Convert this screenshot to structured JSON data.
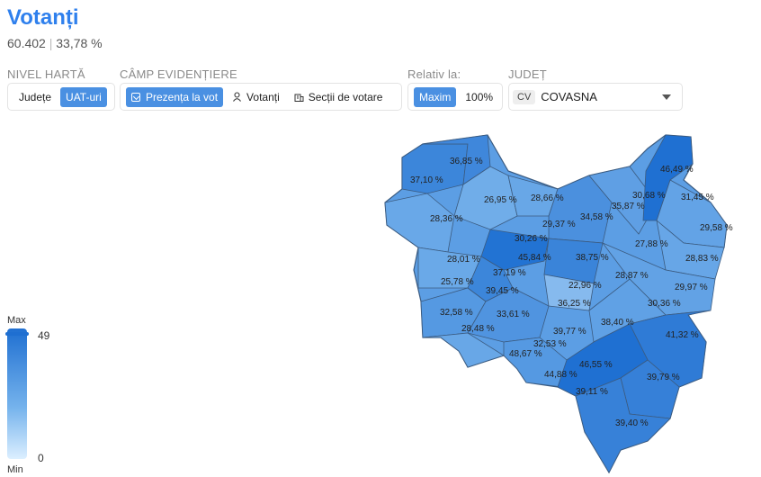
{
  "header": {
    "title": "Votanți",
    "count": "60.402",
    "percent": "33,78 %"
  },
  "nivel_harta": {
    "label": "NIVEL HARTĂ",
    "options": [
      "Județe",
      "UAT-uri"
    ],
    "selected": "UAT-uri"
  },
  "camp": {
    "label": "CÂMP EVIDENȚIERE",
    "options": [
      "Prezența la vot",
      "Votanți",
      "Secții de votare"
    ],
    "selected": "Prezența la vot"
  },
  "relativ": {
    "label": "Relativ la:",
    "options": [
      "Maxim",
      "100%"
    ],
    "selected": "Maxim"
  },
  "judet": {
    "label": "JUDEȚ",
    "code": "CV",
    "name": "COVASNA"
  },
  "legend": {
    "max_label": "Max",
    "min_label": "Min",
    "max_value": "49",
    "min_value": "0",
    "scale_colors": [
      "#1f6fd1",
      "#74b2ec",
      "#dcefff"
    ]
  },
  "map": {
    "regions": [
      {
        "label": "36,85 %",
        "value": 36.85,
        "color": "#3f87db"
      },
      {
        "label": "37,10 %",
        "value": 37.1,
        "color": "#3c86da"
      },
      {
        "label": "28,36 %",
        "value": 28.36,
        "color": "#69a8e8"
      },
      {
        "label": "26,95 %",
        "value": 26.95,
        "color": "#70ade9"
      },
      {
        "label": "28,66 %",
        "value": 28.66,
        "color": "#68a7e7"
      },
      {
        "label": "29,37 %",
        "value": 29.37,
        "color": "#64a4e6"
      },
      {
        "label": "34,58 %",
        "value": 34.58,
        "color": "#4b90de"
      },
      {
        "label": "30,68 %",
        "value": 30.68,
        "color": "#5f9fe4"
      },
      {
        "label": "46,49 %",
        "value": 46.49,
        "color": "#1f70d2"
      },
      {
        "label": "31,45 %",
        "value": 31.45,
        "color": "#5a9ce3"
      },
      {
        "label": "35,87 %",
        "value": 35.87,
        "color": "#448bdc"
      },
      {
        "label": "29,58 %",
        "value": 29.58,
        "color": "#63a3e6"
      },
      {
        "label": "30,26 %",
        "value": 30.26,
        "color": "#60a1e5"
      },
      {
        "label": "27,88 %",
        "value": 27.88,
        "color": "#6baae8"
      },
      {
        "label": "28,83 %",
        "value": 28.83,
        "color": "#67a6e7"
      },
      {
        "label": "28,01 %",
        "value": 28.01,
        "color": "#6aa9e8"
      },
      {
        "label": "45,84 %",
        "value": 45.84,
        "color": "#2273d3"
      },
      {
        "label": "38,75 %",
        "value": 38.75,
        "color": "#3a84d9"
      },
      {
        "label": "37,19 %",
        "value": 37.19,
        "color": "#3c86da"
      },
      {
        "label": "28,87 %",
        "value": 28.87,
        "color": "#67a6e7"
      },
      {
        "label": "25,78 %",
        "value": 25.78,
        "color": "#76b0ea"
      },
      {
        "label": "29,97 %",
        "value": 29.97,
        "color": "#62a2e5"
      },
      {
        "label": "22,96 %",
        "value": 22.96,
        "color": "#86baee"
      },
      {
        "label": "39,45 %",
        "value": 39.45,
        "color": "#3781d8"
      },
      {
        "label": "36,25 %",
        "value": 36.25,
        "color": "#428adb"
      },
      {
        "label": "30,36 %",
        "value": 30.36,
        "color": "#60a1e5"
      },
      {
        "label": "32,58 %",
        "value": 32.58,
        "color": "#5599e2"
      },
      {
        "label": "33,61 %",
        "value": 33.61,
        "color": "#5094e0"
      },
      {
        "label": "38,40 %",
        "value": 38.4,
        "color": "#3983d9"
      },
      {
        "label": "28,48 %",
        "value": 28.48,
        "color": "#68a7e7"
      },
      {
        "label": "39,77 %",
        "value": 39.77,
        "color": "#3680d8"
      },
      {
        "label": "41,32 %",
        "value": 41.32,
        "color": "#2f7bd6"
      },
      {
        "label": "32,53 %",
        "value": 32.53,
        "color": "#5599e2"
      },
      {
        "label": "48,67 %",
        "value": 48.67,
        "color": "#1a6bd0"
      },
      {
        "label": "46,55 %",
        "value": 46.55,
        "color": "#1f70d2"
      },
      {
        "label": "44,88 %",
        "value": 44.88,
        "color": "#2475d3"
      },
      {
        "label": "39,79 %",
        "value": 39.79,
        "color": "#3680d8"
      },
      {
        "label": "39,11 %",
        "value": 39.11,
        "color": "#3882d8"
      },
      {
        "label": "39,40 %",
        "value": 39.4,
        "color": "#3781d8"
      }
    ]
  }
}
